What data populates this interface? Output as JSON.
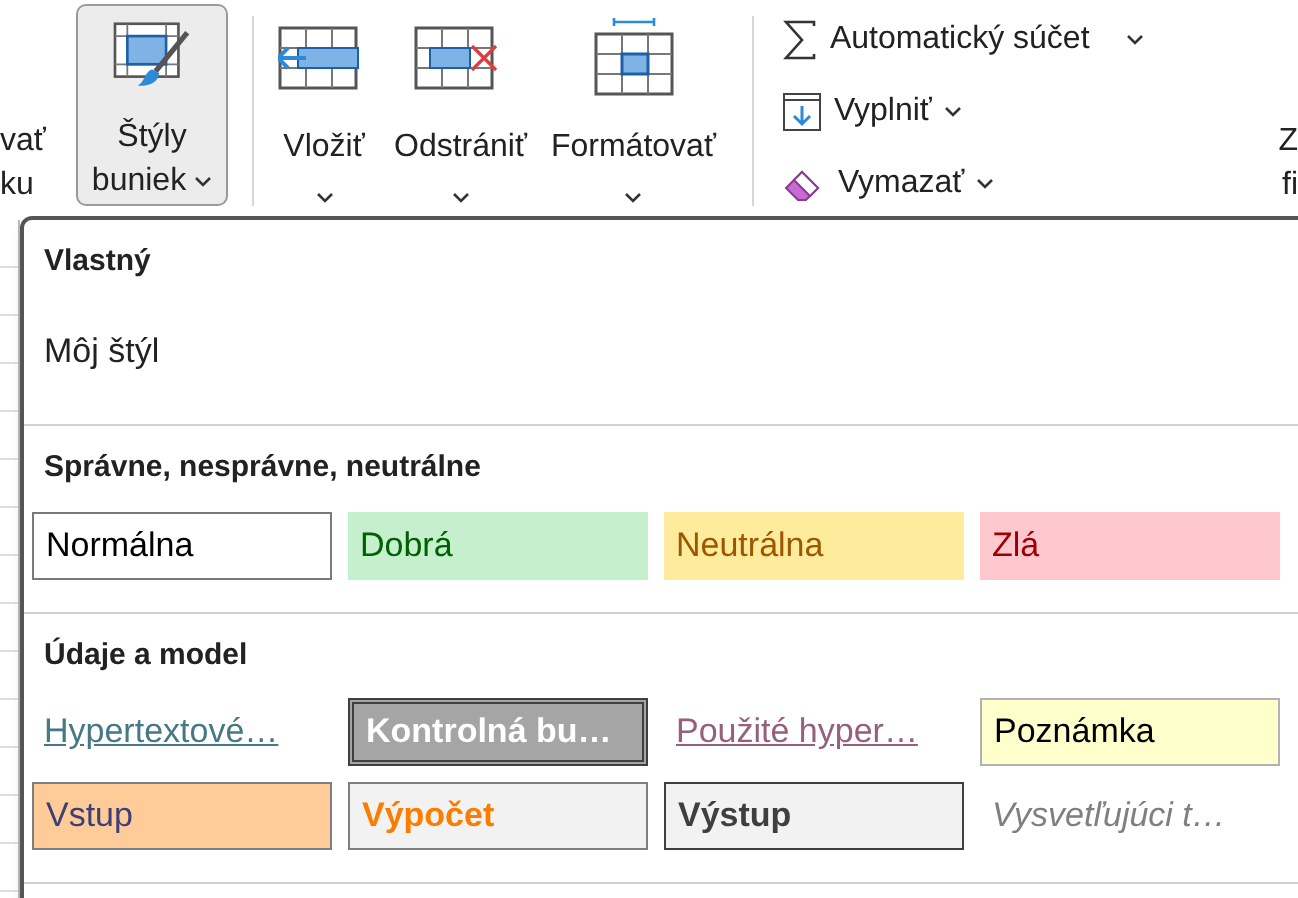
{
  "ribbon": {
    "left_cut": [
      "vať",
      "ku"
    ],
    "styles_button": {
      "lines": [
        "Štýly",
        "buniek"
      ],
      "selected": true
    },
    "cell_buttons": [
      {
        "label": "Vložiť",
        "kind": "insert"
      },
      {
        "label": "Odstrániť",
        "kind": "delete"
      },
      {
        "label": "Formátovať",
        "kind": "format"
      }
    ],
    "editing": [
      {
        "label": "Automatický súčet",
        "kind": "sum"
      },
      {
        "label": "Vyplniť",
        "kind": "fill"
      },
      {
        "label": "Vymazať",
        "kind": "clear"
      }
    ],
    "right_cut": [
      "Z",
      "fi"
    ]
  },
  "menu": {
    "sections": [
      {
        "title": "Vlastný",
        "items": [
          {
            "label": "Môj štýl",
            "kind": "plain"
          }
        ]
      },
      {
        "title": "Správne, nesprávne, neutrálne",
        "items": [
          {
            "label": "Normálna",
            "kind": "normal"
          },
          {
            "label": "Dobrá",
            "kind": "good"
          },
          {
            "label": "Neutrálna",
            "kind": "neutral"
          },
          {
            "label": "Zlá",
            "kind": "bad"
          }
        ]
      },
      {
        "title": "Údaje a model",
        "items": [
          {
            "label": "Hypertextové…",
            "kind": "hyperlink"
          },
          {
            "label": "Kontrolná bu…",
            "kind": "check"
          },
          {
            "label": "Použité hyper…",
            "kind": "followed"
          },
          {
            "label": "Poznámka",
            "kind": "note"
          },
          {
            "label": "Vstup",
            "kind": "input"
          },
          {
            "label": "Výpočet",
            "kind": "calculation"
          },
          {
            "label": "Výstup",
            "kind": "output"
          },
          {
            "label": "Vysvetľujúci t…",
            "kind": "explanatory"
          }
        ]
      }
    ]
  }
}
